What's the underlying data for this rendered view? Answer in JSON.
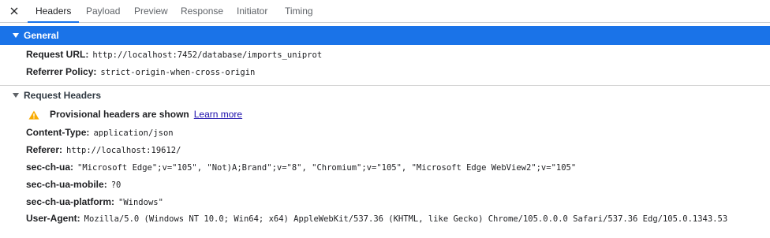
{
  "tabs": [
    {
      "label": "Headers"
    },
    {
      "label": "Payload"
    },
    {
      "label": "Preview"
    },
    {
      "label": "Response"
    },
    {
      "label": "Initiator"
    },
    {
      "label": "Timing"
    }
  ],
  "general": {
    "title": "General",
    "rows": [
      {
        "key": "Request URL:",
        "value": "http://localhost:7452/database/imports_uniprot"
      },
      {
        "key": "Referrer Policy:",
        "value": "strict-origin-when-cross-origin"
      }
    ]
  },
  "request_headers": {
    "title": "Request Headers",
    "warning": {
      "text": "Provisional headers are shown",
      "link": "Learn more"
    },
    "rows": [
      {
        "key": "Content-Type:",
        "value": "application/json"
      },
      {
        "key": "Referer:",
        "value": "http://localhost:19612/"
      },
      {
        "key": "sec-ch-ua:",
        "value": "\"Microsoft Edge\";v=\"105\", \"Not)A;Brand\";v=\"8\", \"Chromium\";v=\"105\", \"Microsoft Edge WebView2\";v=\"105\""
      },
      {
        "key": "sec-ch-ua-mobile:",
        "value": "?0"
      },
      {
        "key": "sec-ch-ua-platform:",
        "value": "\"Windows\""
      },
      {
        "key": "User-Agent:",
        "value": "Mozilla/5.0 (Windows NT 10.0; Win64; x64) AppleWebKit/537.36 (KHTML, like Gecko) Chrome/105.0.0.0 Safari/537.36 Edg/105.0.1343.53"
      }
    ]
  },
  "colors": {
    "accent": "#1a73e8",
    "warning": "#f9ab00",
    "link": "#1a0dab"
  }
}
